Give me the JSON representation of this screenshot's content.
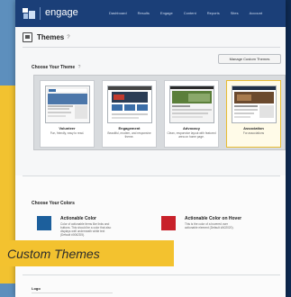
{
  "app": {
    "brand": "engage"
  },
  "nav": {
    "items": [
      "Dashboard",
      "Results",
      "Engage",
      "Content",
      "Reports",
      "Sites",
      "Account"
    ]
  },
  "page": {
    "title": "Themes",
    "help": "?",
    "manage_button": "Manage Custom Themes"
  },
  "choose_theme": {
    "title": "Choose Your Theme",
    "help": "?",
    "themes": [
      {
        "name": "Volunteer",
        "desc": "Fun, friendly, easy to read."
      },
      {
        "name": "Engagement",
        "desc": "Beautiful, modern, and responsive theme."
      },
      {
        "name": "Advocacy",
        "desc": "Clean, responsive layout with featured area on home page."
      },
      {
        "name": "Association",
        "desc": "For associations",
        "selected": true
      }
    ]
  },
  "colors": {
    "title": "Choose Your Colors",
    "items": [
      {
        "name": "Actionable Color",
        "desc": "Color of actionable items like links and buttons. This should be a color that also displays well underneath white text (Default #0062D5).",
        "hex": "#1c5f9c"
      },
      {
        "name": "Actionable Color on Hover",
        "desc": "This is the color of a hovered over actionable element (Default #A02020).",
        "hex": "#c8212a"
      }
    ]
  },
  "logo": {
    "title": "Logo"
  },
  "banner": {
    "text": "Custom Themes"
  }
}
